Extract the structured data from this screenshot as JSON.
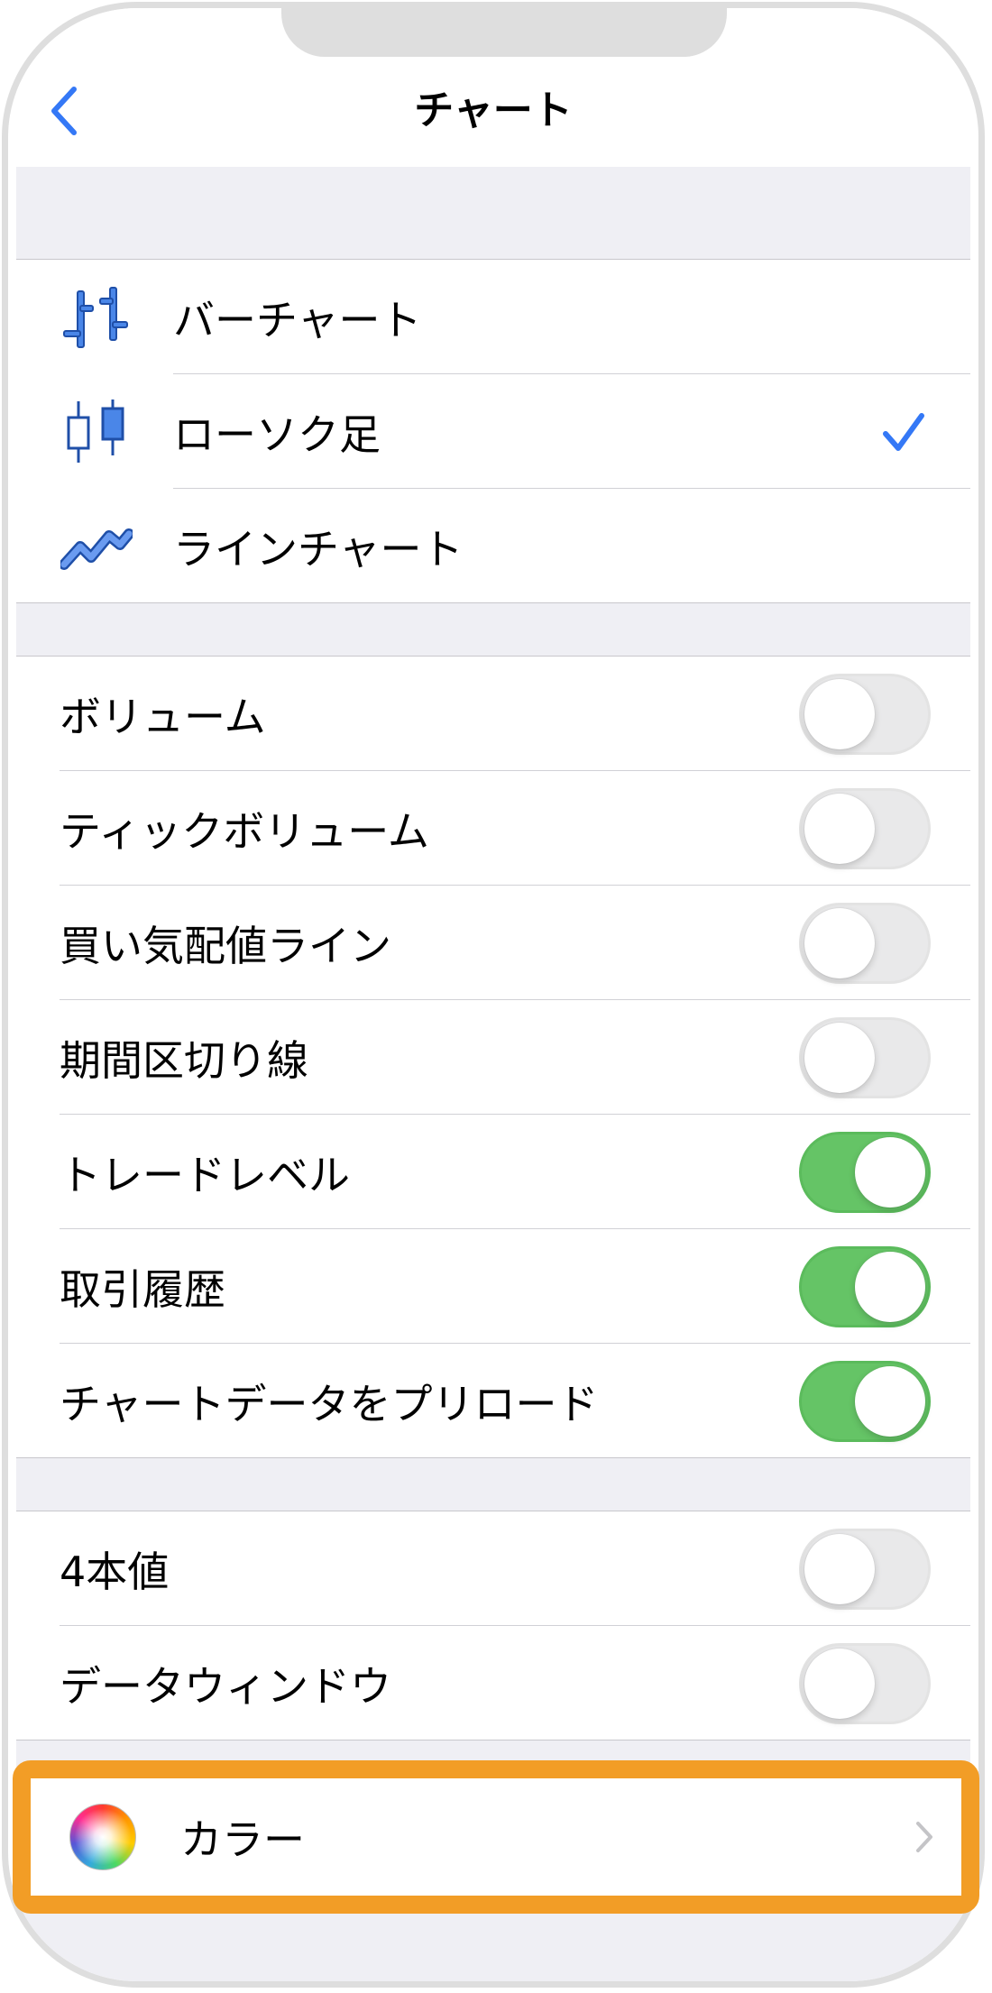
{
  "nav": {
    "title": "チャート",
    "back": "back"
  },
  "chart_types": [
    {
      "label": "バーチャート",
      "icon": "bar-chart-icon",
      "selected": false
    },
    {
      "label": "ローソク足",
      "icon": "candlestick-icon",
      "selected": true
    },
    {
      "label": "ラインチャート",
      "icon": "line-chart-icon",
      "selected": false
    }
  ],
  "options": [
    {
      "label": "ボリューム",
      "on": false
    },
    {
      "label": "ティックボリューム",
      "on": false
    },
    {
      "label": "買い気配値ライン",
      "on": false
    },
    {
      "label": "期間区切り線",
      "on": false
    },
    {
      "label": "トレードレベル",
      "on": true
    },
    {
      "label": "取引履歴",
      "on": true
    },
    {
      "label": "チャートデータをプリロード",
      "on": true
    }
  ],
  "options2": [
    {
      "label": "4本値",
      "on": false
    },
    {
      "label": "データウィンドウ",
      "on": false
    }
  ],
  "color_row": {
    "label": "カラー",
    "icon": "color-wheel-icon"
  },
  "colors": {
    "accent": "#3478f6",
    "toggle_on": "#65c466",
    "toggle_off": "#e9e9ea",
    "highlight": "#f29d26",
    "group_bg": "#efeff4"
  }
}
